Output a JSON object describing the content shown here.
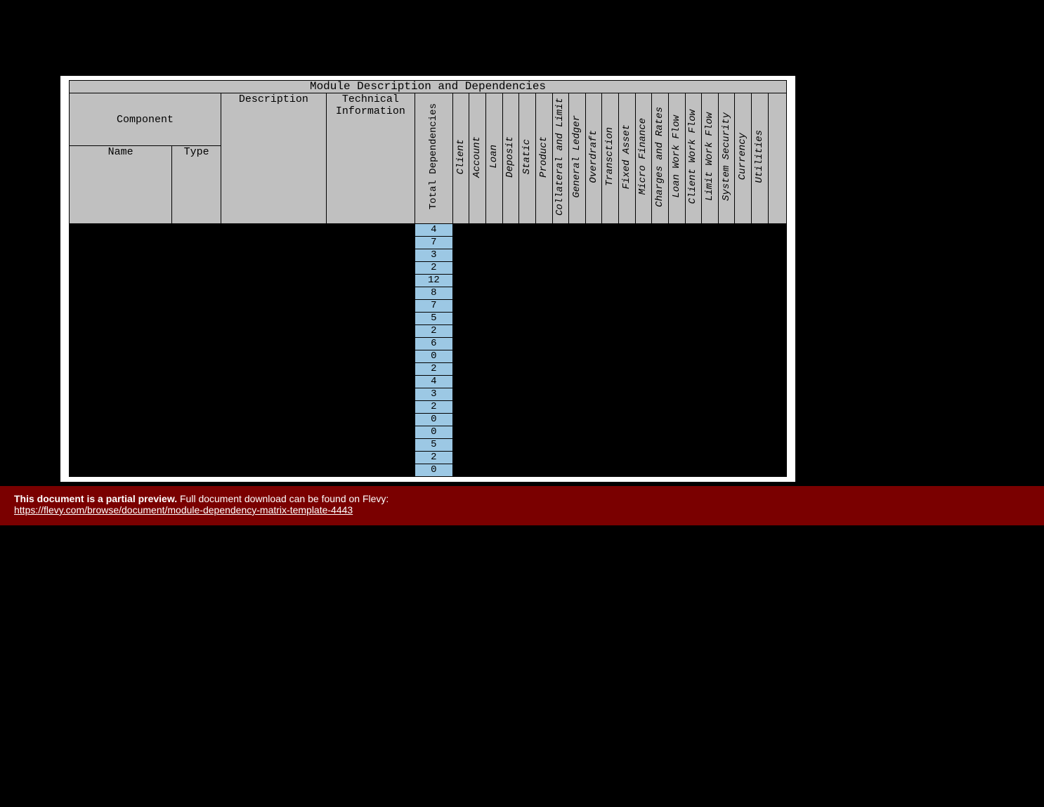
{
  "title": "Module Description and Dependencies",
  "header": {
    "component": "Component",
    "name": "Name",
    "type": "Type",
    "description": "Description",
    "technical": "Technical Information",
    "total_deps": "Total Dependencies"
  },
  "modules": [
    "Client",
    "Account",
    "Loan",
    "Deposit",
    "Static",
    "Product",
    "Collateral and Limit",
    "General Ledger",
    "Overdraft",
    "Transction",
    "Fixed Asset",
    "Micro Finance",
    "Charges and Rates",
    "Loan Work Flow",
    "Client Work Flow",
    "Limit Work Flow",
    "System Security",
    "Currency",
    "Utilities"
  ],
  "totals": [
    4,
    7,
    3,
    2,
    12,
    8,
    7,
    5,
    2,
    6,
    0,
    2,
    4,
    3,
    2,
    0,
    0,
    5,
    2,
    0
  ],
  "footer": {
    "bold": "This document is a partial preview.",
    "rest": " Full document download can be found on Flevy:",
    "link": "https://flevy.com/browse/document/module-dependency-matrix-template-4443"
  }
}
